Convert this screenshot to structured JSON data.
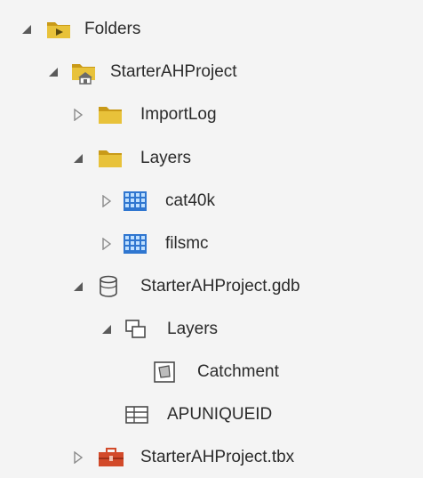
{
  "tree": {
    "items": [
      {
        "label": "Folders",
        "icon": "folder-connection-icon",
        "expanded": true
      },
      {
        "label": "StarterAHProject",
        "icon": "home-folder-icon",
        "expanded": true
      },
      {
        "label": "ImportLog",
        "icon": "folder-icon",
        "expanded": false
      },
      {
        "label": "Layers",
        "icon": "folder-icon",
        "expanded": true
      },
      {
        "label": "cat40k",
        "icon": "raster-icon",
        "expanded": false
      },
      {
        "label": "filsmc",
        "icon": "raster-icon",
        "expanded": false
      },
      {
        "label": "StarterAHProject.gdb",
        "icon": "geodatabase-icon",
        "expanded": true
      },
      {
        "label": "Layers",
        "icon": "feature-dataset-icon",
        "expanded": true
      },
      {
        "label": "Catchment",
        "icon": "polygon-feature-class-icon"
      },
      {
        "label": "APUNIQUEID",
        "icon": "table-icon"
      },
      {
        "label": "StarterAHProject.tbx",
        "icon": "toolbox-icon",
        "expanded": false
      }
    ]
  },
  "colors": {
    "folder": "#e8c23a",
    "folder_dark": "#c99a18",
    "raster": "#2f76d0",
    "toolbox": "#d24a2a",
    "expander": "#5a5a5a",
    "text": "#2b2b2b"
  }
}
